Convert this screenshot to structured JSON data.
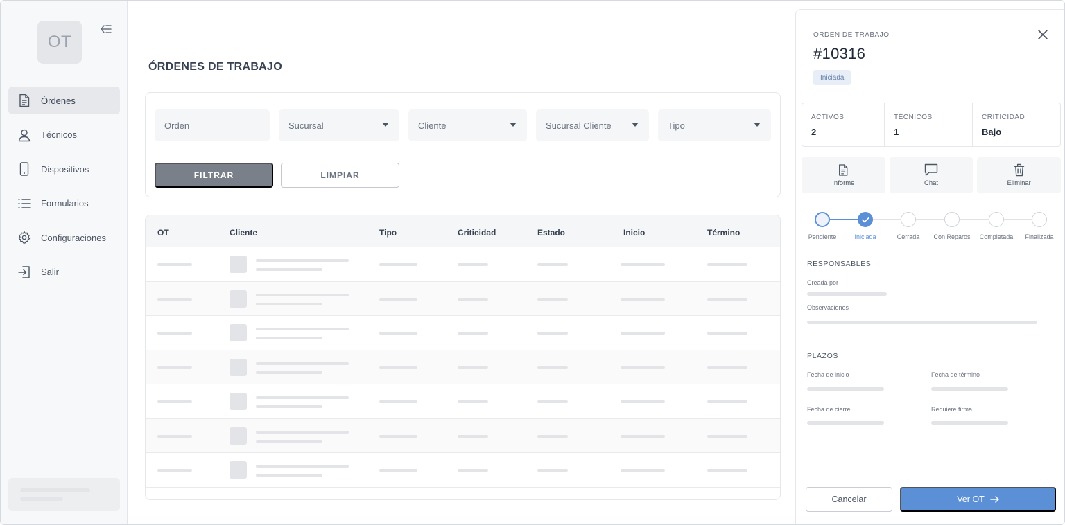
{
  "sidebar": {
    "logo": "OT",
    "items": [
      {
        "label": "Órdenes",
        "icon": "document-icon",
        "active": true
      },
      {
        "label": "Técnicos",
        "icon": "user-icon"
      },
      {
        "label": "Dispositivos",
        "icon": "phone-icon"
      },
      {
        "label": "Formularios",
        "icon": "list-icon"
      },
      {
        "label": "Configuraciones",
        "icon": "gear-icon"
      },
      {
        "label": "Salir",
        "icon": "logout-icon"
      }
    ]
  },
  "main": {
    "title": "ÓRDENES DE TRABAJO",
    "filters": {
      "orden_placeholder": "Orden",
      "sucursal": "Sucursal",
      "cliente": "Cliente",
      "sucursal_cliente": "Sucursal Cliente",
      "tipo": "Tipo",
      "filtrar_label": "FILTRAR",
      "limpiar_label": "LIMPIAR"
    },
    "table": {
      "columns": [
        "OT",
        "Cliente",
        "Tipo",
        "Criticidad",
        "Estado",
        "Inicio",
        "Término"
      ]
    }
  },
  "panel": {
    "heading_label": "ORDEN DE TRABAJO",
    "order_number": "#10316",
    "status_badge": "Iniciada",
    "stats": [
      {
        "label": "ACTIVOS",
        "value": "2"
      },
      {
        "label": "TÉCNICOS",
        "value": "1"
      },
      {
        "label": "CRITICIDAD",
        "value": "Bajo"
      }
    ],
    "actions": [
      {
        "label": "Informe",
        "icon": "document-icon"
      },
      {
        "label": "Chat",
        "icon": "chat-icon"
      },
      {
        "label": "Eliminar",
        "icon": "trash-icon"
      }
    ],
    "steps": [
      "Pendiente",
      "Iniciada",
      "Cerrada",
      "Con Reparos",
      "Completada",
      "Finalizada"
    ],
    "current_step": "Iniciada",
    "responsables": {
      "title": "RESPONSABLES",
      "creada_por": "Creada por",
      "observaciones": "Observaciones"
    },
    "plazos": {
      "title": "PLAZOS",
      "fecha_inicio": "Fecha de inicio",
      "fecha_termino": "Fecha de término",
      "fecha_cierre": "Fecha de cierre",
      "requiere_firma": "Requiere firma"
    },
    "footer": {
      "cancel_label": "Cancelar",
      "ver_label": "Ver OT"
    }
  },
  "colors": {
    "accent": "#5b8fd6",
    "filter_button": "#7a8089",
    "badge_bg": "#e8eef7"
  }
}
